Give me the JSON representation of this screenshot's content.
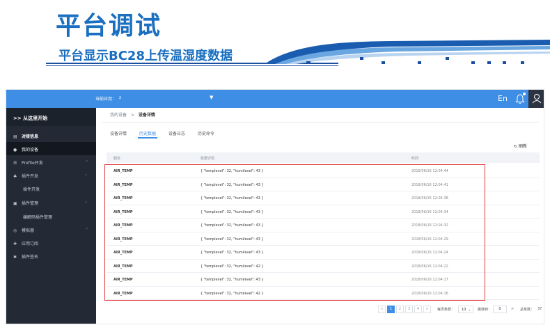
{
  "slide": {
    "title": "平台调试",
    "subtitle": "平台显示BC28上传温湿度数据"
  },
  "topbar": {
    "app_label": "当前应用：",
    "app_value": "z",
    "lang": "En",
    "color": "#3f8ee6"
  },
  "sidebar": {
    "header": "从这里开始",
    "items": [
      {
        "label": "对接信息",
        "icon": "window-icon"
      },
      {
        "label": "我的设备",
        "icon": "device-icon"
      },
      {
        "label": "Profile开发",
        "icon": "list-icon"
      },
      {
        "label": "插件开发",
        "icon": "plugin-icon"
      },
      {
        "label": "插件开发"
      },
      {
        "label": "插件管理",
        "icon": "manage-icon"
      },
      {
        "label": "编解码插件管理"
      },
      {
        "label": "模拟器",
        "icon": "simulator-icon"
      },
      {
        "label": "应用订阅",
        "icon": "subscribe-icon"
      },
      {
        "label": "插件签名",
        "icon": "signature-icon"
      }
    ]
  },
  "breadcrumb": {
    "parent": "我的设备",
    "separator": ">",
    "current": "设备详情"
  },
  "tabs": [
    "设备详情",
    "历史数据",
    "设备日志",
    "历史命令"
  ],
  "refresh_label": "刷新",
  "table": {
    "headers": [
      "服务",
      "数据详情",
      "时间"
    ],
    "rows": [
      {
        "service": "AIR_TEMP",
        "data": "{ \"templevel\": 32, \"humilevel\": 43 }",
        "time": "2018/06/16 12:04:44"
      },
      {
        "service": "AIR_TEMP",
        "data": "{ \"templevel\": 32, \"humilevel\": 43 }",
        "time": "2018/06/16 12:04:41"
      },
      {
        "service": "AIR_TEMP",
        "data": "{ \"templevel\": 32, \"humilevel\": 43 }",
        "time": "2018/06/16 12:04:38"
      },
      {
        "service": "AIR_TEMP",
        "data": "{ \"templevel\": 32, \"humilevel\": 43 }",
        "time": "2018/06/16 12:04:34"
      },
      {
        "service": "AIR_TEMP",
        "data": "{ \"templevel\": 32, \"humilevel\": 43 }",
        "time": "2018/06/16 12:04:32"
      },
      {
        "service": "AIR_TEMP",
        "data": "{ \"templevel\": 32, \"humilevel\": 43 }",
        "time": "2018/06/16 12:04:29"
      },
      {
        "service": "AIR_TEMP",
        "data": "{ \"templevel\": 32, \"humilevel\": 43 }",
        "time": "2018/06/16 12:04:24"
      },
      {
        "service": "AIR_TEMP",
        "data": "{ \"templevel\": 32, \"humilevel\": 42 }",
        "time": "2018/06/16 12:04:22"
      },
      {
        "service": "AIR_TEMP",
        "data": "{ \"templevel\": 32, \"humilevel\": 43 }",
        "time": "2018/06/16 12:04:17"
      },
      {
        "service": "AIR_TEMP",
        "data": "{ \"templevel\": 32, \"humilevel\": 42 }",
        "time": "2018/06/16 12:04:16"
      }
    ]
  },
  "pagination": {
    "prev": "<",
    "pages": [
      "1",
      "2",
      "3",
      "4"
    ],
    "next": ">",
    "page_size_label": "每页条数：",
    "page_size": "10",
    "jump_label": "跳转到：",
    "jump_value": "0",
    "total_label": "总条数：",
    "total": "37"
  }
}
